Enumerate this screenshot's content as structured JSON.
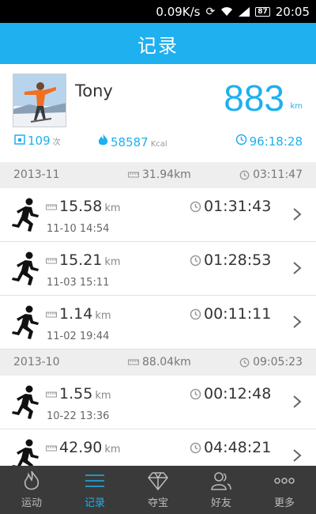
{
  "status_bar": {
    "speed": "0.09K/s",
    "battery": "87",
    "time": "20:05"
  },
  "header": {
    "title": "记录"
  },
  "profile": {
    "name": "Tony",
    "total_distance": "883",
    "total_distance_unit": "km",
    "runs_count": "109",
    "runs_unit": "次",
    "calories": "58587",
    "calories_unit": "Kcal",
    "total_time": "96:18:28"
  },
  "months": [
    {
      "name": "2013-11",
      "distance": "31.94km",
      "time": "03:11:47",
      "runs": [
        {
          "distance": "15.58",
          "unit": "km",
          "date": "11-10 14:54",
          "time": "01:31:43"
        },
        {
          "distance": "15.21",
          "unit": "km",
          "date": "11-03 15:11",
          "time": "01:28:53"
        },
        {
          "distance": "1.14",
          "unit": "km",
          "date": "11-02 19:44",
          "time": "00:11:11"
        }
      ]
    },
    {
      "name": "2013-10",
      "distance": "88.04km",
      "time": "09:05:23",
      "runs": [
        {
          "distance": "1.55",
          "unit": "km",
          "date": "10-22 13:36",
          "time": "00:12:48"
        },
        {
          "distance": "42.90",
          "unit": "km",
          "date": "",
          "time": "04:48:21"
        }
      ]
    }
  ],
  "bottom_nav": [
    {
      "label": "运动",
      "icon": "flame-icon",
      "active": false
    },
    {
      "label": "记录",
      "icon": "list-icon",
      "active": true
    },
    {
      "label": "夺宝",
      "icon": "diamond-icon",
      "active": false
    },
    {
      "label": "好友",
      "icon": "friends-icon",
      "active": false
    },
    {
      "label": "更多",
      "icon": "more-icon",
      "active": false
    }
  ],
  "colors": {
    "accent": "#1eb0ef",
    "nav_bg": "#3a3a3a",
    "section_bg": "#eeeeee"
  }
}
